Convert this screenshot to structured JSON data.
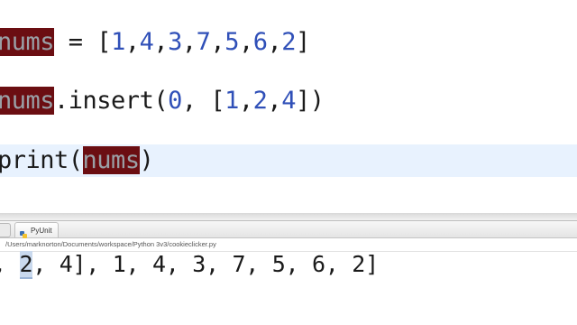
{
  "editor": {
    "line1": {
      "var": "nums",
      "assign": " = [",
      "values": [
        "1",
        "4",
        "3",
        "7",
        "5",
        "6",
        "2"
      ],
      "close": "]"
    },
    "line2": {
      "var": "nums",
      "method": ".insert(",
      "index": "0",
      "sep": ", [",
      "values": [
        "1",
        "2",
        "4"
      ],
      "close": "])"
    },
    "line3": {
      "func": "print(",
      "arg": "nums",
      "close": ")"
    }
  },
  "console": {
    "tab_label": "PyUnit",
    "path": "/Users/marknorton/Documents/workspace/Python 3v3/cookieclicker.py",
    "output_prefix": ", ",
    "output_selected": "2",
    "output_rest": ", 4], 1, 4, 3, 7, 5, 6, 2]"
  },
  "colors": {
    "occurrence_highlight": "#6b0e12",
    "current_line": "#e8f2fe",
    "number": "#3050b8"
  }
}
